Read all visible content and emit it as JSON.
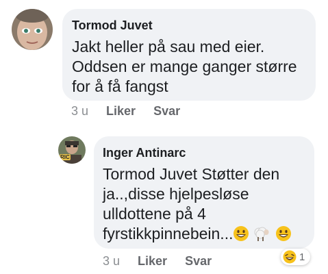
{
  "comments": [
    {
      "author": "Tormod Juvet",
      "text": "Jakt heller på sau med eier.\nOddsen er mange ganger større\nfor å få fangst",
      "time": "3 u",
      "like_label": "Liker",
      "reply_label": "Svar"
    },
    {
      "author": "Inger Antinarc",
      "text_main": "Tormod Juvet Støtter den\nja..,disse hjelpesløse\nulldottene på 4\nfyrstikkpinnebein...",
      "time": "3 u",
      "like_label": "Liker",
      "reply_label": "Svar",
      "reaction_count": "1",
      "avatar_badge": "RIC"
    }
  ],
  "colors": {
    "bubble": "#f0f2f5",
    "text": "#1c1e21",
    "meta": "#65676b"
  },
  "icons": [
    "smiley-emoji",
    "sheep-emoji",
    "laughing-reaction-icon"
  ]
}
